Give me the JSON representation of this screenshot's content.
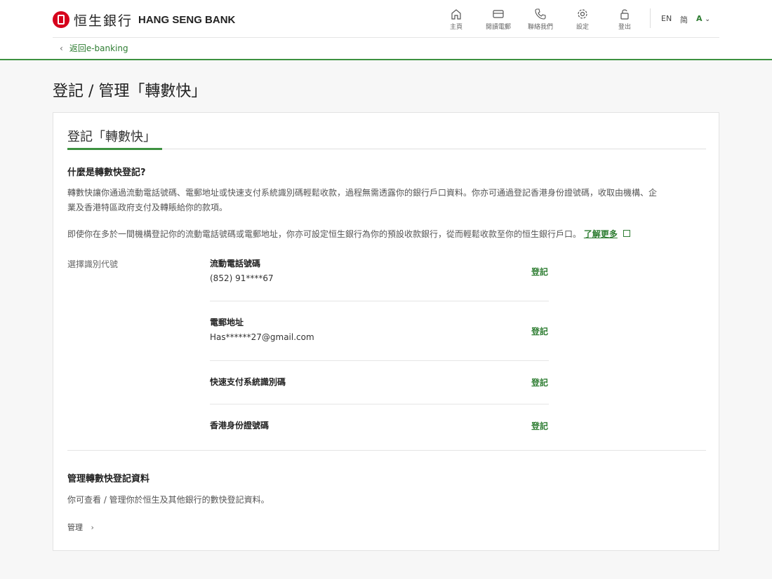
{
  "header": {
    "logo_cjk": "恒生銀行",
    "logo_en": "HANG SENG BANK",
    "nav": [
      {
        "label": "主頁",
        "icon": "home-icon"
      },
      {
        "label": "閱讀電郵",
        "icon": "mail-icon"
      },
      {
        "label": "聯絡我們",
        "icon": "phone-icon"
      },
      {
        "label": "設定",
        "icon": "gear-icon"
      },
      {
        "label": "登出",
        "icon": "lock-icon"
      }
    ],
    "lang_en": "EN",
    "lang_sc": "简",
    "font_size": "A",
    "back_label": "返回e-banking",
    "accent": "#3d9140"
  },
  "page": {
    "title": "登記 / 管理「轉數快」"
  },
  "card": {
    "tab_label": "登記「轉數快」",
    "section1_title": "什麼是轉數快登記?",
    "para1_line1": "轉數快讓你通過流動電話號碼、電郵地址或快速支付系統識別碼輕鬆收款，過程無需透露你的銀行戶口資料。你亦可通過登記香港身份證號碼，收取由機構、企",
    "para1_line2": "業及香港特區政府支付及轉賬給你的款項。",
    "para2": "即使你在多於一間機構登記你的流動電話號碼或電郵地址，你亦可設定恒生銀行為你的預設收款銀行，從而輕鬆收款至你的恒生銀行戶口。",
    "learn_more": "了解更多",
    "select_label": "選擇識別代號",
    "options": [
      {
        "title": "流動電話號碼",
        "value": "(852) 91****67",
        "action": "登記"
      },
      {
        "title": "電郵地址",
        "value": "Has******27@gmail.com",
        "action": "登記"
      },
      {
        "title": "快速支付系統識別碼",
        "value": "",
        "action": "登記"
      },
      {
        "title": "香港身份證號碼",
        "value": "",
        "action": "登記"
      }
    ],
    "section2_title": "管理轉數快登記資料",
    "section2_text": "你可查看 / 管理你於恒生及其他銀行的數快登記資料。",
    "manage_label": "管理"
  }
}
